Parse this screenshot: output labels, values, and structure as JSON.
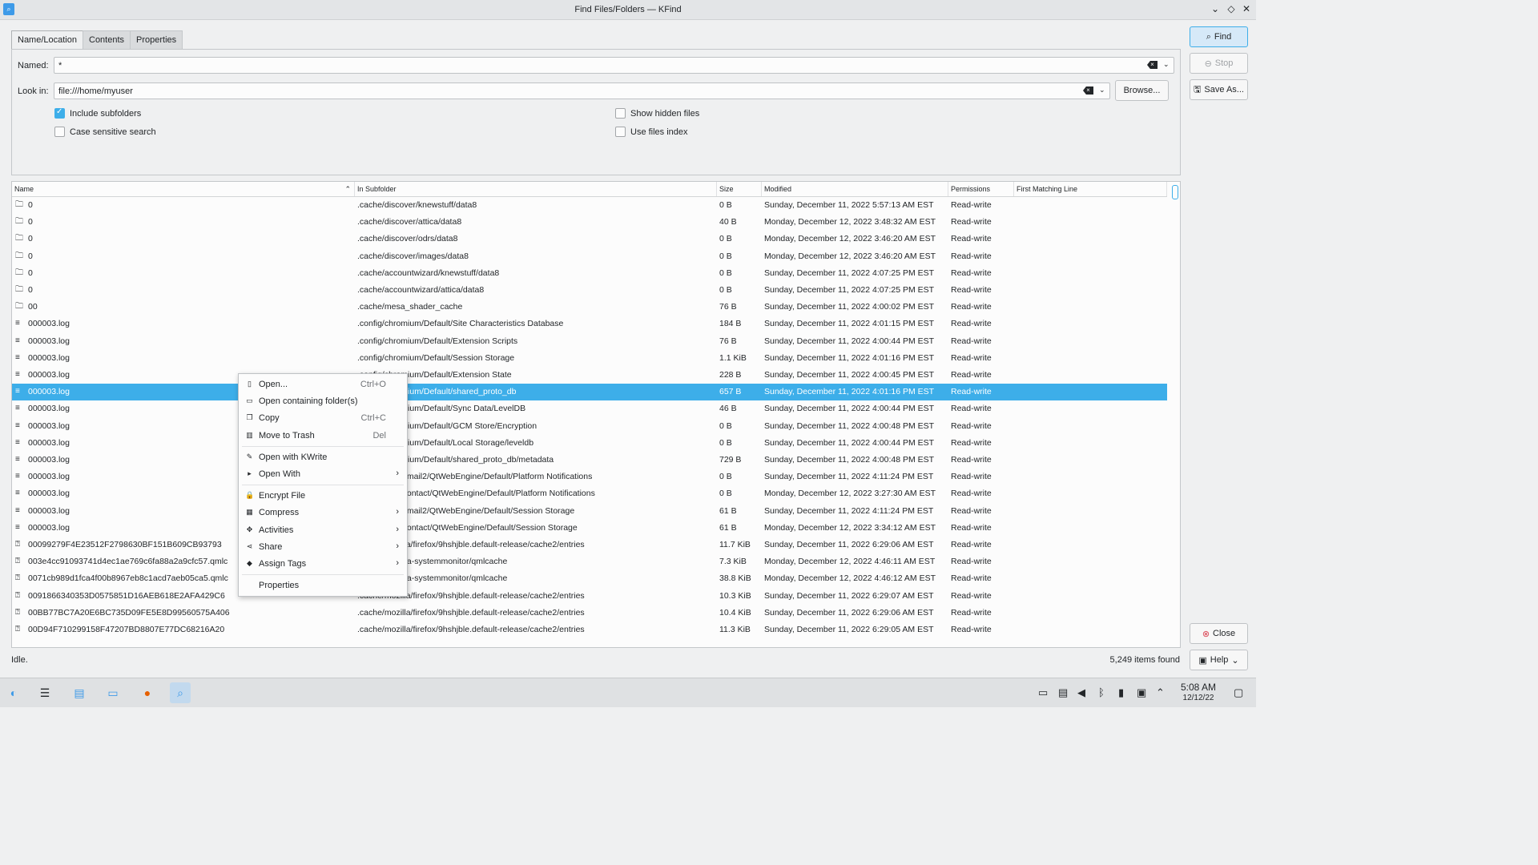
{
  "window": {
    "title": "Find Files/Folders — KFind"
  },
  "tabs": [
    "Name/Location",
    "Contents",
    "Properties"
  ],
  "named": {
    "label": "Named:",
    "value": "*"
  },
  "look_in": {
    "label": "Look in:",
    "value": "file:///home/myuser",
    "browse": "Browse..."
  },
  "options": {
    "include_subfolders": "Include subfolders",
    "case_sensitive": "Case sensitive search",
    "show_hidden": "Show hidden files",
    "use_index": "Use files index"
  },
  "side_buttons": {
    "find": "Find",
    "stop": "Stop",
    "save_as": "Save As...",
    "close": "Close",
    "help": "Help"
  },
  "columns": [
    "Name",
    "In Subfolder",
    "Size",
    "Modified",
    "Permissions",
    "First Matching Line"
  ],
  "rows": [
    {
      "name": "0",
      "sub": ".cache/discover/knewstuff/data8",
      "size": "0 B",
      "mod": "Sunday, December 11, 2022 5:57:13 AM EST",
      "perm": "Read-write",
      "type": "folder"
    },
    {
      "name": "0",
      "sub": ".cache/discover/attica/data8",
      "size": "40 B",
      "mod": "Monday, December 12, 2022 3:48:32 AM EST",
      "perm": "Read-write",
      "type": "folder"
    },
    {
      "name": "0",
      "sub": ".cache/discover/odrs/data8",
      "size": "0 B",
      "mod": "Monday, December 12, 2022 3:46:20 AM EST",
      "perm": "Read-write",
      "type": "folder"
    },
    {
      "name": "0",
      "sub": ".cache/discover/images/data8",
      "size": "0 B",
      "mod": "Monday, December 12, 2022 3:46:20 AM EST",
      "perm": "Read-write",
      "type": "folder"
    },
    {
      "name": "0",
      "sub": ".cache/accountwizard/knewstuff/data8",
      "size": "0 B",
      "mod": "Sunday, December 11, 2022 4:07:25 PM EST",
      "perm": "Read-write",
      "type": "folder"
    },
    {
      "name": "0",
      "sub": ".cache/accountwizard/attica/data8",
      "size": "0 B",
      "mod": "Sunday, December 11, 2022 4:07:25 PM EST",
      "perm": "Read-write",
      "type": "folder"
    },
    {
      "name": "00",
      "sub": ".cache/mesa_shader_cache",
      "size": "76 B",
      "mod": "Sunday, December 11, 2022 4:00:02 PM EST",
      "perm": "Read-write",
      "type": "folder"
    },
    {
      "name": "000003.log",
      "sub": ".config/chromium/Default/Site Characteristics Database",
      "size": "184 B",
      "mod": "Sunday, December 11, 2022 4:01:15 PM EST",
      "perm": "Read-write",
      "type": "text"
    },
    {
      "name": "000003.log",
      "sub": ".config/chromium/Default/Extension Scripts",
      "size": "76 B",
      "mod": "Sunday, December 11, 2022 4:00:44 PM EST",
      "perm": "Read-write",
      "type": "text"
    },
    {
      "name": "000003.log",
      "sub": ".config/chromium/Default/Session Storage",
      "size": "1.1 KiB",
      "mod": "Sunday, December 11, 2022 4:01:16 PM EST",
      "perm": "Read-write",
      "type": "text"
    },
    {
      "name": "000003.log",
      "sub": ".config/chromium/Default/Extension State",
      "size": "228 B",
      "mod": "Sunday, December 11, 2022 4:00:45 PM EST",
      "perm": "Read-write",
      "type": "text"
    },
    {
      "name": "000003.log",
      "sub": ".config/chromium/Default/shared_proto_db",
      "size": "657 B",
      "mod": "Sunday, December 11, 2022 4:01:16 PM EST",
      "perm": "Read-write",
      "type": "text",
      "selected": true
    },
    {
      "name": "000003.log",
      "sub": ".config/chromium/Default/Sync Data/LevelDB",
      "size": "46 B",
      "mod": "Sunday, December 11, 2022 4:00:44 PM EST",
      "perm": "Read-write",
      "type": "text"
    },
    {
      "name": "000003.log",
      "sub": ".config/chromium/Default/GCM Store/Encryption",
      "size": "0 B",
      "mod": "Sunday, December 11, 2022 4:00:48 PM EST",
      "perm": "Read-write",
      "type": "text"
    },
    {
      "name": "000003.log",
      "sub": ".config/chromium/Default/Local Storage/leveldb",
      "size": "0 B",
      "mod": "Sunday, December 11, 2022 4:00:44 PM EST",
      "perm": "Read-write",
      "type": "text"
    },
    {
      "name": "000003.log",
      "sub": ".config/chromium/Default/shared_proto_db/metadata",
      "size": "729 B",
      "mod": "Sunday, December 11, 2022 4:00:48 PM EST",
      "perm": "Read-write",
      "type": "text"
    },
    {
      "name": "000003.log",
      "sub": ".local/share/kmail2/QtWebEngine/Default/Platform Notifications",
      "size": "0 B",
      "mod": "Sunday, December 11, 2022 4:11:24 PM EST",
      "perm": "Read-write",
      "type": "text"
    },
    {
      "name": "000003.log",
      "sub": ".local/share/kontact/QtWebEngine/Default/Platform Notifications",
      "size": "0 B",
      "mod": "Monday, December 12, 2022 3:27:30 AM EST",
      "perm": "Read-write",
      "type": "text"
    },
    {
      "name": "000003.log",
      "sub": ".local/share/kmail2/QtWebEngine/Default/Session Storage",
      "size": "61 B",
      "mod": "Sunday, December 11, 2022 4:11:24 PM EST",
      "perm": "Read-write",
      "type": "text"
    },
    {
      "name": "000003.log",
      "sub": ".local/share/kontact/QtWebEngine/Default/Session Storage",
      "size": "61 B",
      "mod": "Monday, December 12, 2022 3:34:12 AM EST",
      "perm": "Read-write",
      "type": "text"
    },
    {
      "name": "00099279F4E23512F2798630BF151B609CB93793",
      "sub": ".cache/mozilla/firefox/9hshjble.default-release/cache2/entries",
      "size": "11.7 KiB",
      "mod": "Sunday, December 11, 2022 6:29:06 AM EST",
      "perm": "Read-write",
      "type": "unknown"
    },
    {
      "name": "003e4cc91093741d4ec1ae769c6fa88a2a9cfc57.qmlc",
      "sub": ".cache/plasma-systemmonitor/qmlcache",
      "size": "7.3 KiB",
      "mod": "Monday, December 12, 2022 4:46:11 AM EST",
      "perm": "Read-write",
      "type": "unknown"
    },
    {
      "name": "0071cb989d1fca4f00b8967eb8c1acd7aeb05ca5.qmlc",
      "sub": ".cache/plasma-systemmonitor/qmlcache",
      "size": "38.8 KiB",
      "mod": "Monday, December 12, 2022 4:46:12 AM EST",
      "perm": "Read-write",
      "type": "unknown"
    },
    {
      "name": "0091866340353D0575851D16AEB618E2AFA429C6",
      "sub": ".cache/mozilla/firefox/9hshjble.default-release/cache2/entries",
      "size": "10.3 KiB",
      "mod": "Sunday, December 11, 2022 6:29:07 AM EST",
      "perm": "Read-write",
      "type": "unknown"
    },
    {
      "name": "00BB77BC7A20E6BC735D09FE5E8D99560575A406",
      "sub": ".cache/mozilla/firefox/9hshjble.default-release/cache2/entries",
      "size": "10.4 KiB",
      "mod": "Sunday, December 11, 2022 6:29:06 AM EST",
      "perm": "Read-write",
      "type": "unknown"
    },
    {
      "name": "00D94F710299158F47207BD8807E77DC68216A20",
      "sub": ".cache/mozilla/firefox/9hshjble.default-release/cache2/entries",
      "size": "11.3 KiB",
      "mod": "Sunday, December 11, 2022 6:29:05 AM EST",
      "perm": "Read-write",
      "type": "unknown"
    }
  ],
  "context_menu": [
    {
      "label": "Open...",
      "shortcut": "Ctrl+O",
      "icon": "open-icon"
    },
    {
      "label": "Open containing folder(s)",
      "shortcut": "",
      "icon": "folder-open-icon"
    },
    {
      "label": "Copy",
      "shortcut": "Ctrl+C",
      "icon": "copy-icon"
    },
    {
      "label": "Move to Trash",
      "shortcut": "Del",
      "icon": "trash-icon"
    },
    {
      "sep": true
    },
    {
      "label": "Open with KWrite",
      "shortcut": "",
      "icon": "kwrite-icon"
    },
    {
      "label": "Open With",
      "shortcut": "",
      "icon": "open-with-icon",
      "submenu": true
    },
    {
      "sep": true
    },
    {
      "label": "Encrypt File",
      "shortcut": "",
      "icon": "lock-icon"
    },
    {
      "label": "Compress",
      "shortcut": "",
      "icon": "compress-icon",
      "submenu": true
    },
    {
      "label": "Activities",
      "shortcut": "",
      "icon": "activities-icon",
      "submenu": true
    },
    {
      "label": "Share",
      "shortcut": "",
      "icon": "share-icon",
      "submenu": true
    },
    {
      "label": "Assign Tags",
      "shortcut": "",
      "icon": "tag-icon",
      "submenu": true
    },
    {
      "sep": true
    },
    {
      "label": "Properties",
      "shortcut": "",
      "icon": ""
    }
  ],
  "status": {
    "text": "Idle.",
    "count": "5,249 items found"
  },
  "taskbar": {
    "time": "5:08 AM",
    "date": "12/12/22"
  },
  "colors": {
    "accent": "#3daee9"
  }
}
